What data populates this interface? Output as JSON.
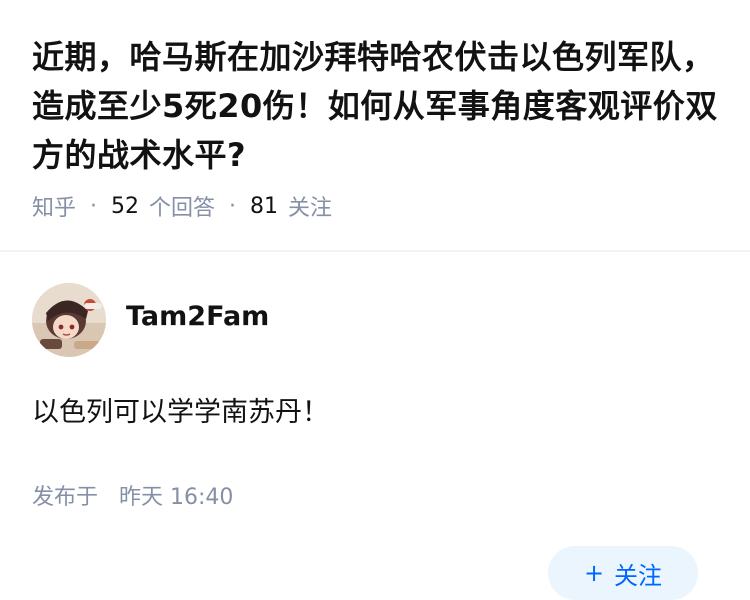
{
  "question": {
    "title": "近期，哈马斯在加沙拜特哈农伏击以色列军队，造成至少5死20伤！如何从军事角度客观评价双方的战术水平?",
    "source": "知乎",
    "answer_count": "52",
    "answer_label": "个回答",
    "follower_count": "81",
    "follower_label": "关注"
  },
  "answer": {
    "author": "Tam2Fam",
    "avatar_icon": "anime-girl-avatar",
    "follow_button": {
      "icon": "plus-icon",
      "label": "关注"
    },
    "content": "以色列可以学学南苏丹！",
    "posted_label": "发布于",
    "posted_time": "昨天 16:40"
  },
  "colors": {
    "primary": "#0066ff",
    "button_bg": "#ebf5fd",
    "meta": "#8590a6",
    "text": "#121212"
  }
}
